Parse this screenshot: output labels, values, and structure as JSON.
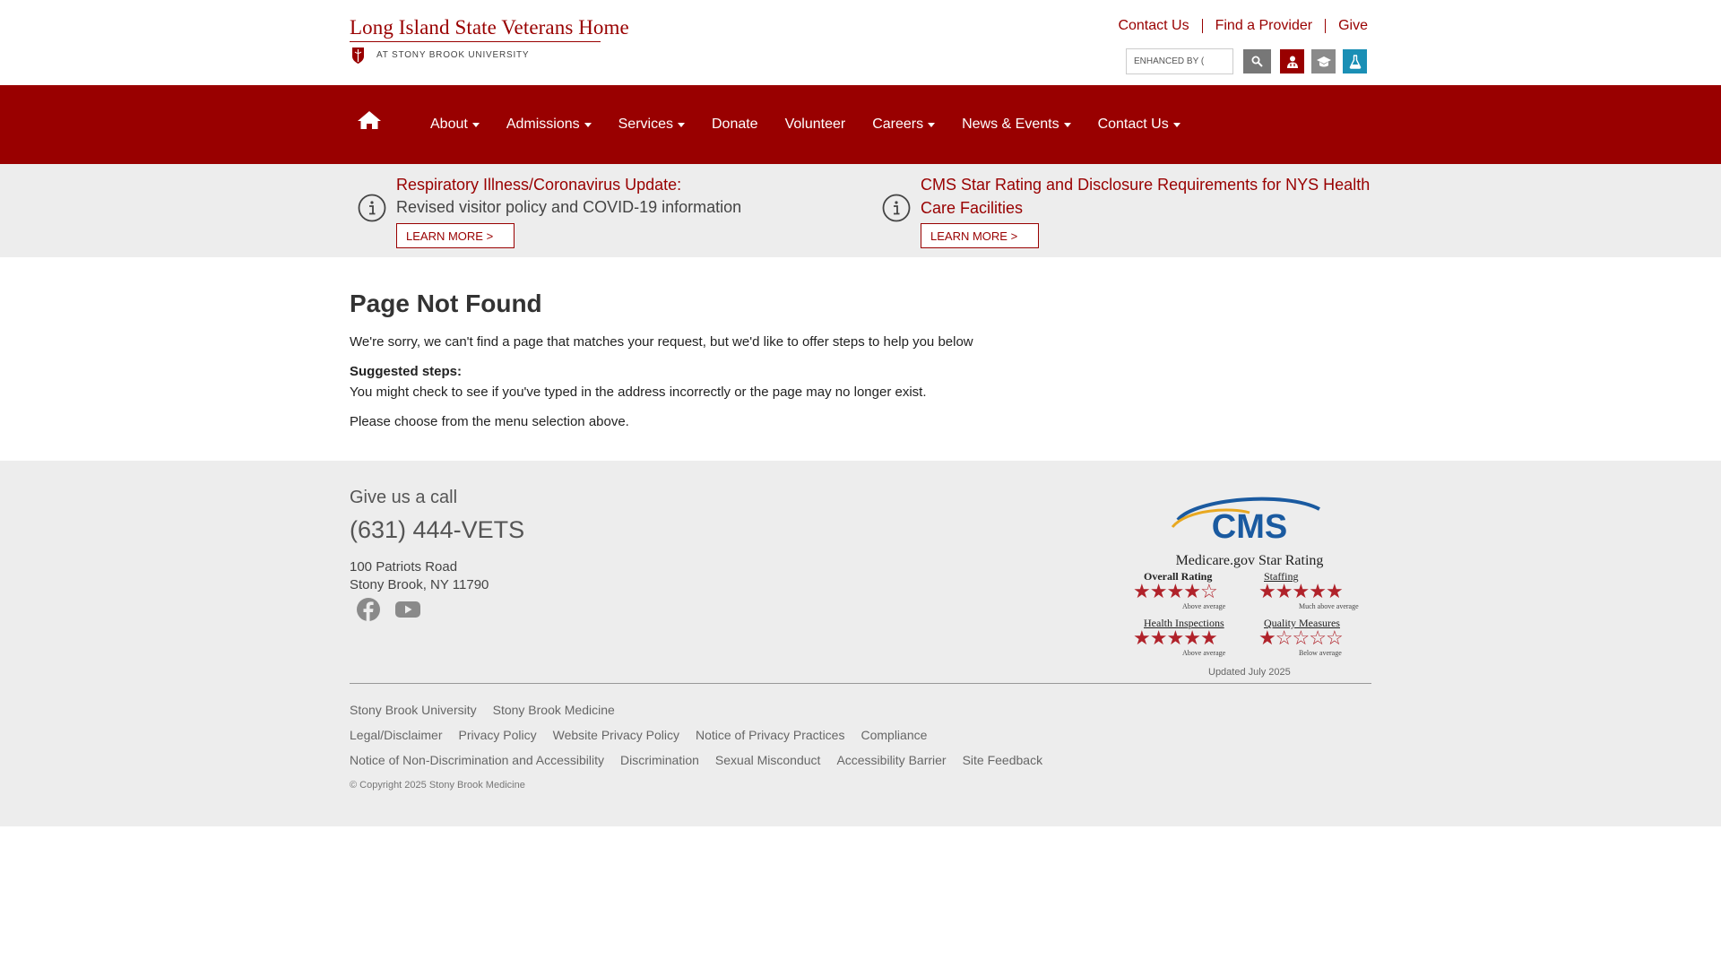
{
  "header": {
    "logo_title": "Long Island State Veterans Home",
    "logo_subtitle": "AT STONY BROOK UNIVERSITY",
    "top_links": [
      "Contact Us",
      "Find a Provider",
      "Give"
    ],
    "search_placeholder": "ENHANCED BY (",
    "colors": {
      "brand": "#990000",
      "util1": "#990000",
      "util2": "#8a8a8a",
      "util3": "#1a8fb5"
    }
  },
  "nav": {
    "items": [
      {
        "label": "About",
        "dropdown": true
      },
      {
        "label": "Admissions",
        "dropdown": true
      },
      {
        "label": "Services",
        "dropdown": true
      },
      {
        "label": "Donate",
        "dropdown": false
      },
      {
        "label": "Volunteer",
        "dropdown": false
      },
      {
        "label": "Careers",
        "dropdown": true
      },
      {
        "label": "News & Events",
        "dropdown": true
      },
      {
        "label": "Contact Us",
        "dropdown": true
      }
    ]
  },
  "alerts": [
    {
      "title": "Respiratory Illness/Coronavirus Update:",
      "desc": "Revised visitor policy and COVID-19 information",
      "button": "LEARN MORE >"
    },
    {
      "title_line1": "CMS Star Rating and Disclosure Requirements for NYS Health",
      "title_line2": "Care Facilities",
      "button": "LEARN MORE >"
    }
  ],
  "main": {
    "title": "Page Not Found",
    "intro": "We're sorry, we can't find a page that matches your request, but we'd like to offer steps to help you below",
    "steps_heading": "Suggested steps:",
    "step1": "You might check to see if you've typed in the address incorrectly or the page may no longer exist.",
    "step2": "Please choose from the menu selection above."
  },
  "footer": {
    "call_label": "Give us a call",
    "phone": "(631) 444-VETS",
    "address1": "100 Patriots Road",
    "address2": "Stony Brook, NY 11790",
    "cms": {
      "logo_text": "CMS",
      "caption": "Medicare.gov  Star Rating",
      "ratings": [
        {
          "label": "Overall Rating",
          "stars": 4,
          "note": "Above average"
        },
        {
          "label": "Staffing",
          "stars": 5,
          "note": "Much above average"
        },
        {
          "label": "Health Inspections",
          "stars": 5,
          "note": "Above average"
        },
        {
          "label": "Quality Measures",
          "stars": 1,
          "note": "Below average"
        }
      ],
      "updated": "Updated July 2025"
    },
    "links_row1": [
      "Stony Brook University",
      "Stony Brook Medicine"
    ],
    "links_row2": [
      "Legal/Disclaimer",
      "Privacy Policy",
      "Website Privacy Policy",
      "Notice of Privacy Practices",
      "Compliance"
    ],
    "links_row3": [
      "Notice of Non-Discrimination and Accessibility",
      "Discrimination",
      "Sexual Misconduct",
      "Accessibility Barrier",
      "Site Feedback"
    ],
    "copyright": "© Copyright 2025 Stony Brook Medicine"
  }
}
